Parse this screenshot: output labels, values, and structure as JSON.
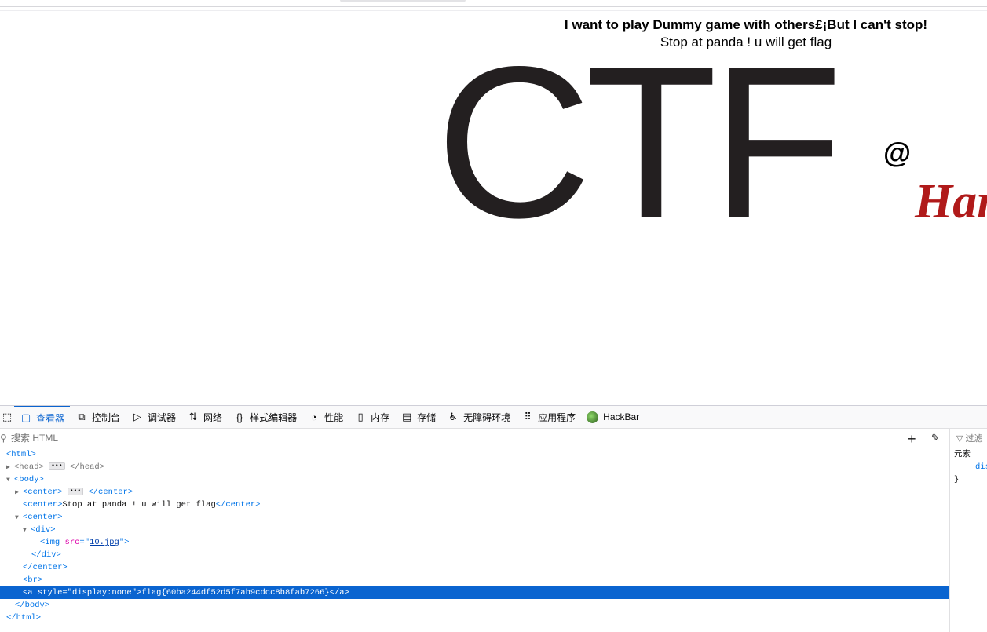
{
  "page": {
    "headline": "I want to play Dummy game with others£¡But I can't stop!",
    "subline": "Stop at panda ! u will get flag",
    "logo_text": "CTF",
    "at_symbol": "@",
    "hard_text": "Har"
  },
  "devtools": {
    "tabs": [
      {
        "label": "查看器",
        "icon": "inspector-icon",
        "glyph": "▢"
      },
      {
        "label": "控制台",
        "icon": "console-icon",
        "glyph": "⧉"
      },
      {
        "label": "调试器",
        "icon": "debugger-icon",
        "glyph": "▷"
      },
      {
        "label": "网络",
        "icon": "network-icon",
        "glyph": "⇅"
      },
      {
        "label": "样式编辑器",
        "icon": "style-editor-icon",
        "glyph": "{}"
      },
      {
        "label": "性能",
        "icon": "performance-icon",
        "glyph": "◔"
      },
      {
        "label": "内存",
        "icon": "memory-icon",
        "glyph": "▯"
      },
      {
        "label": "存储",
        "icon": "storage-icon",
        "glyph": "▤"
      },
      {
        "label": "无障碍环境",
        "icon": "accessibility-icon",
        "glyph": "♿"
      },
      {
        "label": "应用程序",
        "icon": "application-icon",
        "glyph": "⠿"
      },
      {
        "label": "HackBar",
        "icon": "hackbar-icon",
        "glyph": ""
      }
    ],
    "search_placeholder": "搜索 HTML",
    "side_filter": "过滤",
    "side_element_label": "元素",
    "side_prop": "dis",
    "side_close": "}",
    "tree": {
      "html_open": "<html>",
      "head_open": "<head>",
      "head_close": "</head>",
      "body_open": "<body>",
      "center_open": "<center>",
      "center_close": "</center>",
      "center_text": "Stop at panda ! u will get flag",
      "div_open": "<div>",
      "img_pre": "<img ",
      "img_attr": "src",
      "img_eq": "=\"",
      "img_src": "10.jpg",
      "img_post": "\">",
      "div_close": "</div>",
      "br": "<br>",
      "a_pre": "<a ",
      "a_attr": "style",
      "a_val": "=\"display:none\">",
      "a_text": "flag{60ba244df52d5f7ab9cdcc8b8fab7266}",
      "a_close": "</a>",
      "body_close": "</body>",
      "html_close": "</html>"
    }
  }
}
